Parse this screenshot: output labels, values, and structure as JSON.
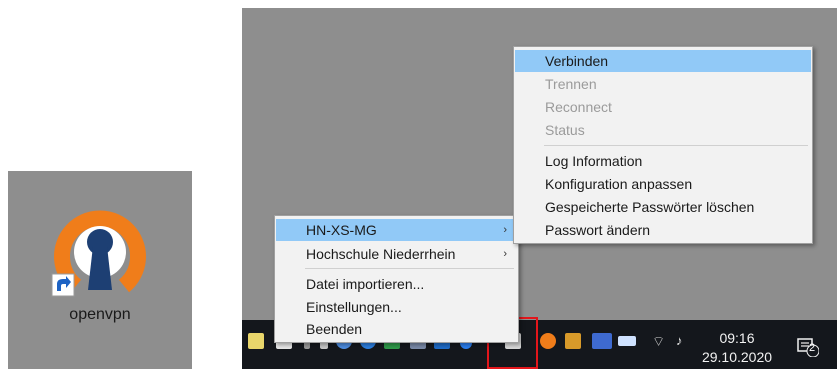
{
  "desktop_shortcut": {
    "label": "openvpn"
  },
  "submenu": {
    "items": [
      {
        "label": "Verbinden",
        "state": "selected"
      },
      {
        "label": "Trennen",
        "state": "disabled"
      },
      {
        "label": "Reconnect",
        "state": "disabled"
      },
      {
        "label": "Status",
        "state": "disabled"
      },
      {
        "label": "Log Information",
        "state": "normal"
      },
      {
        "label": "Konfiguration anpassen",
        "state": "normal"
      },
      {
        "label": "Gespeicherte Passwörter löschen",
        "state": "normal"
      },
      {
        "label": "Passwort ändern",
        "state": "normal"
      }
    ]
  },
  "main_menu": {
    "items": [
      {
        "label": "HN-XS-MG",
        "state": "selected",
        "has_submenu": true
      },
      {
        "label": "Hochschule Niederrhein",
        "state": "normal",
        "has_submenu": true
      },
      {
        "label": "Datei importieren...",
        "state": "normal"
      },
      {
        "label": "Einstellungen...",
        "state": "normal"
      },
      {
        "label": "Beenden",
        "state": "normal"
      }
    ],
    "submenu_arrow": "›"
  },
  "taskbar": {
    "time": "09:16",
    "date": "29.10.2020",
    "notification_count": "2",
    "colors": {
      "bar": "#14171c",
      "menu_highlight": "#91c9f7",
      "callout": "#e3161b",
      "vpn_orange": "#f07d1a",
      "vpn_navy": "#1d3f73"
    }
  }
}
